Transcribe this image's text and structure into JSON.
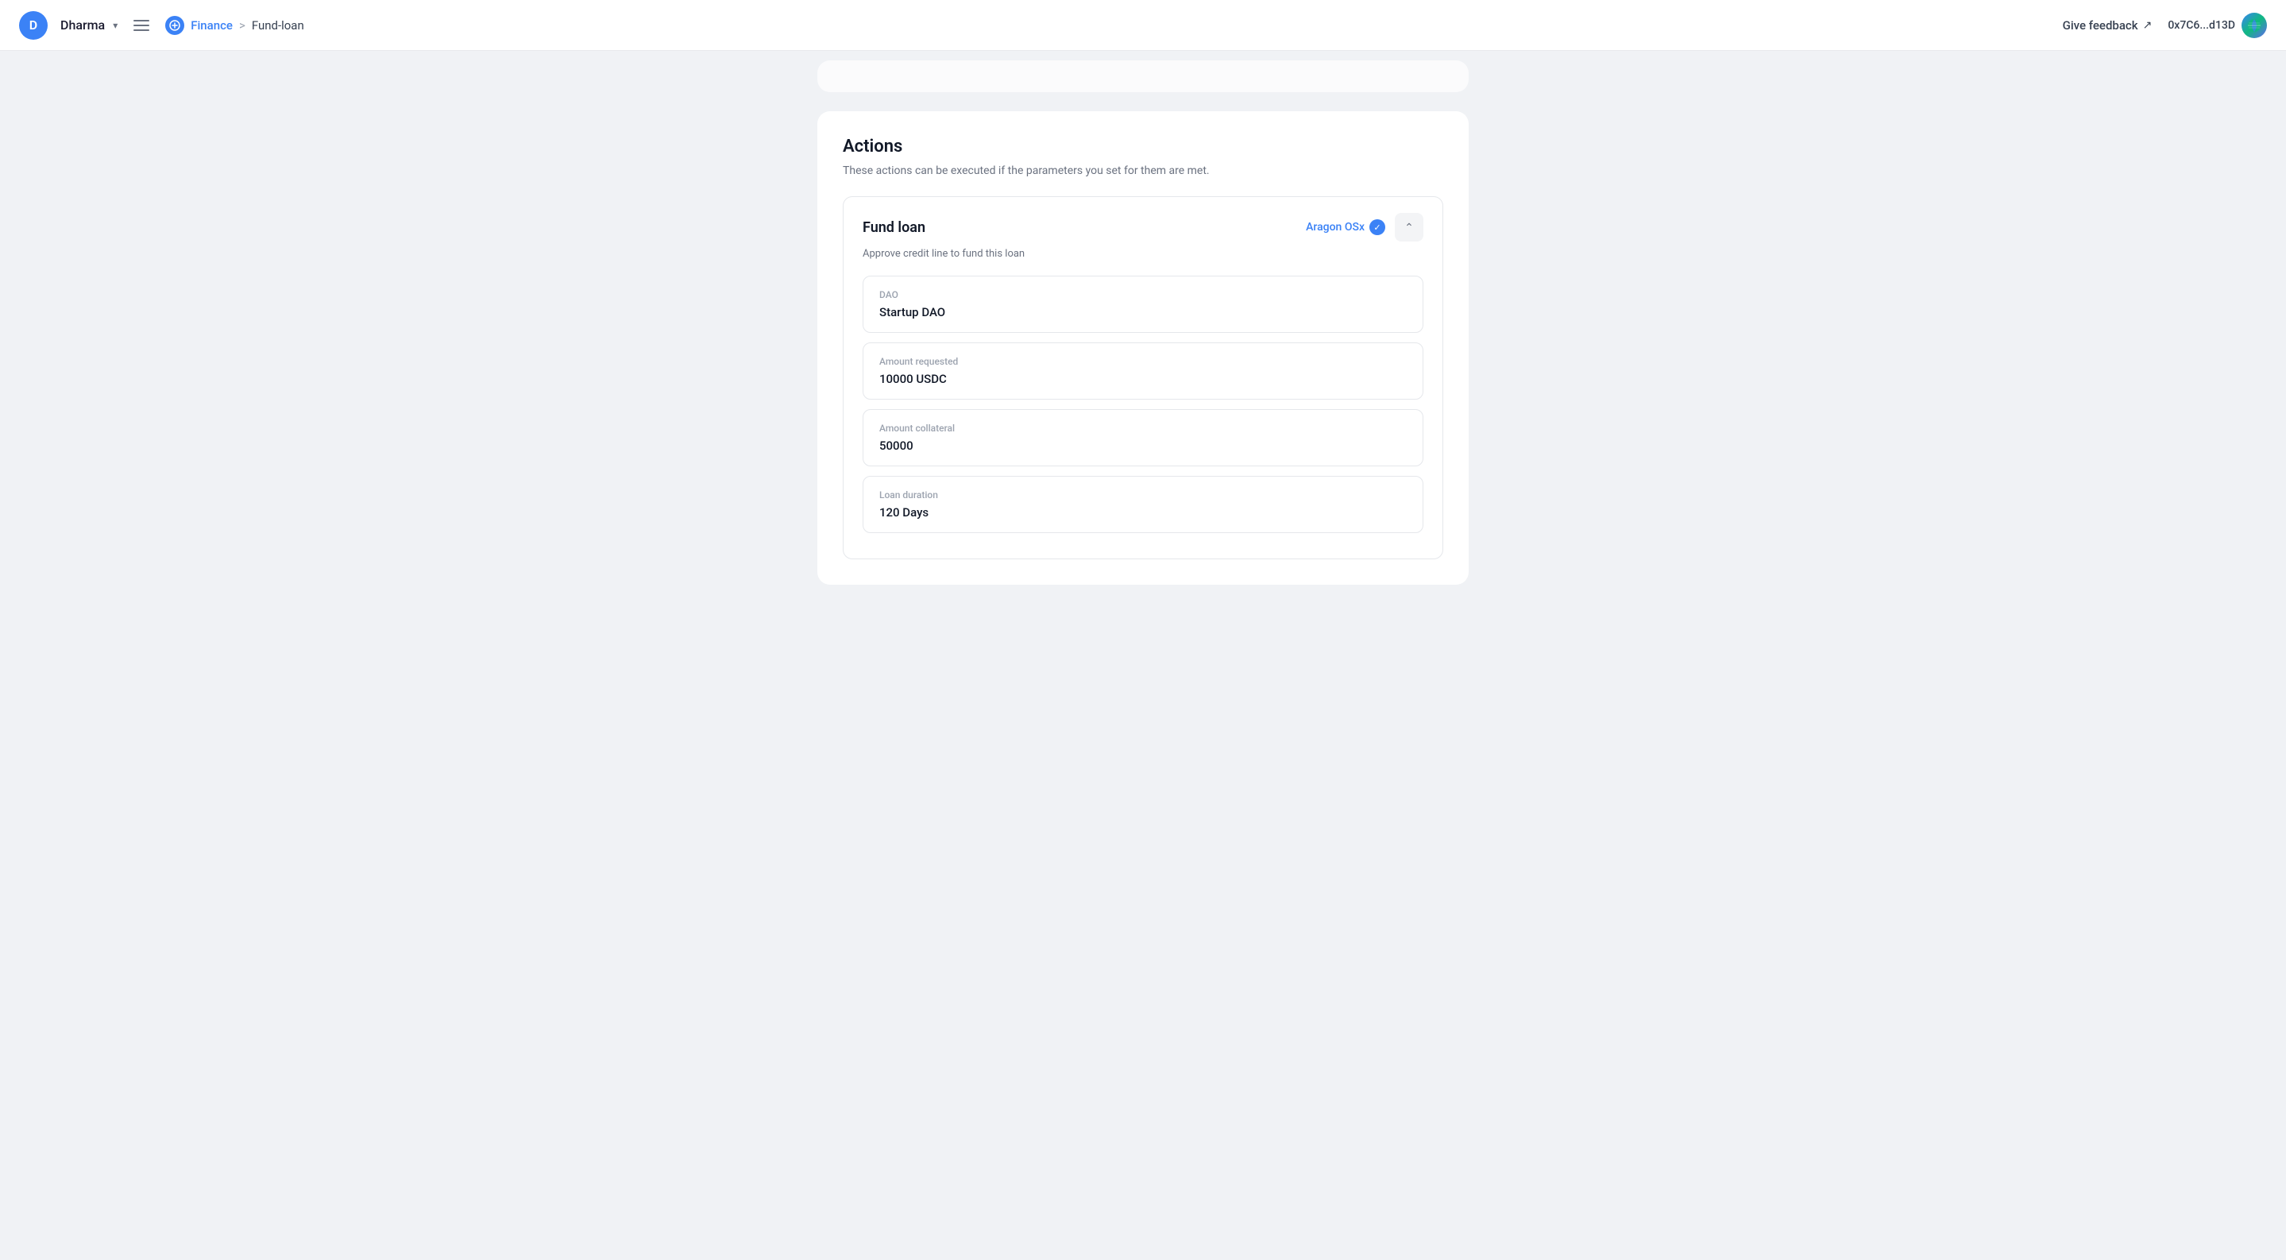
{
  "navbar": {
    "avatar_letter": "D",
    "org_name": "Dharma",
    "menu_icon_label": "menu",
    "finance_label": "Finance",
    "breadcrumb_separator": ">",
    "current_page": "Fund-loan",
    "give_feedback_label": "Give feedback",
    "wallet_address": "0x7C6...d13D"
  },
  "actions_section": {
    "title": "Actions",
    "subtitle": "These actions can be executed if the parameters you set for them are met.",
    "fund_loan": {
      "title": "Fund loan",
      "verified_badge": "Aragon OSx",
      "collapse_icon": "chevron-up",
      "description": "Approve credit line to fund this loan",
      "fields": [
        {
          "label": "DAO",
          "value": "Startup DAO"
        },
        {
          "label": "Amount requested",
          "value": "10000 USDC"
        },
        {
          "label": "Amount collateral",
          "value": "50000"
        },
        {
          "label": "Loan duration",
          "value": "120 Days"
        }
      ]
    }
  }
}
